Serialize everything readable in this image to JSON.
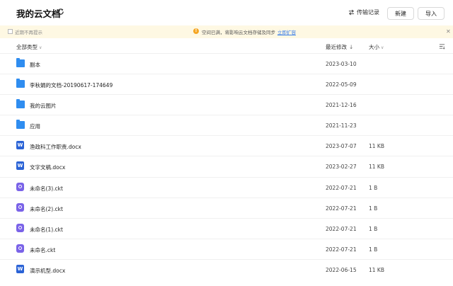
{
  "header": {
    "title": "我的云文档",
    "transfer_label": "传输记录",
    "new_label": "新建",
    "import_label": "导入"
  },
  "notice": {
    "dont_remind_label": "近期不再提示",
    "message": "空间已满，将影响云文档存储及同步",
    "upgrade_link": "立即扩容"
  },
  "columns": {
    "type_label": "全部类型",
    "modified_label": "最近修改",
    "size_label": "大小"
  },
  "files": [
    {
      "type": "folder",
      "icon": "folder-icon",
      "name": "副本",
      "date": "2023-03-10",
      "size": ""
    },
    {
      "type": "folder",
      "icon": "folder-icon",
      "name": "李秋娟的文档-20190617-174649",
      "date": "2022-05-09",
      "size": ""
    },
    {
      "type": "folder",
      "icon": "folder-icon",
      "name": "我的云图片",
      "date": "2021-12-16",
      "size": ""
    },
    {
      "type": "folder",
      "icon": "folder-icon",
      "name": "应用",
      "date": "2021-11-23",
      "size": ""
    },
    {
      "type": "docx",
      "icon": "word-icon",
      "name": "渔政科工作职责.docx",
      "date": "2023-07-07",
      "size": "11 KB"
    },
    {
      "type": "docx",
      "icon": "word-icon",
      "name": "文字文稿.docx",
      "date": "2023-02-27",
      "size": "11 KB"
    },
    {
      "type": "ckt",
      "icon": "ckt-icon",
      "name": "未命名(3).ckt",
      "date": "2022-07-21",
      "size": "1 B"
    },
    {
      "type": "ckt",
      "icon": "ckt-icon",
      "name": "未命名(2).ckt",
      "date": "2022-07-21",
      "size": "1 B"
    },
    {
      "type": "ckt",
      "icon": "ckt-icon",
      "name": "未命名(1).ckt",
      "date": "2022-07-21",
      "size": "1 B"
    },
    {
      "type": "ckt",
      "icon": "ckt-icon",
      "name": "未命名.ckt",
      "date": "2022-07-21",
      "size": "1 B"
    },
    {
      "type": "docx",
      "icon": "word-icon",
      "name": "演示机型.docx",
      "date": "2022-06-15",
      "size": "11 KB"
    }
  ],
  "colors": {
    "folder": "#2f8df0",
    "word": "#2b63d6",
    "ckt": "#7a63e8",
    "notice_bg": "#fef8e3",
    "link": "#3a7ee8"
  }
}
